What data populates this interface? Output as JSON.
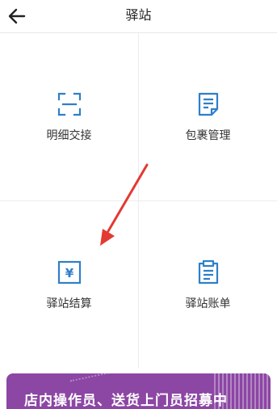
{
  "header": {
    "title": "驿站",
    "back_icon": "arrow-left-icon"
  },
  "grid": {
    "items": [
      {
        "label": "明细交接",
        "icon": "scan-frame-icon"
      },
      {
        "label": "包裹管理",
        "icon": "document-list-icon"
      },
      {
        "label": "驿站结算",
        "icon": "yuan-box-icon"
      },
      {
        "label": "驿站账单",
        "icon": "clipboard-icon"
      }
    ]
  },
  "banner": {
    "text": "店内操作员、送货上门员招募中"
  },
  "colors": {
    "icon": "#2f7fc8",
    "arrow": "#e23a33",
    "banner": "#8c46a4"
  }
}
